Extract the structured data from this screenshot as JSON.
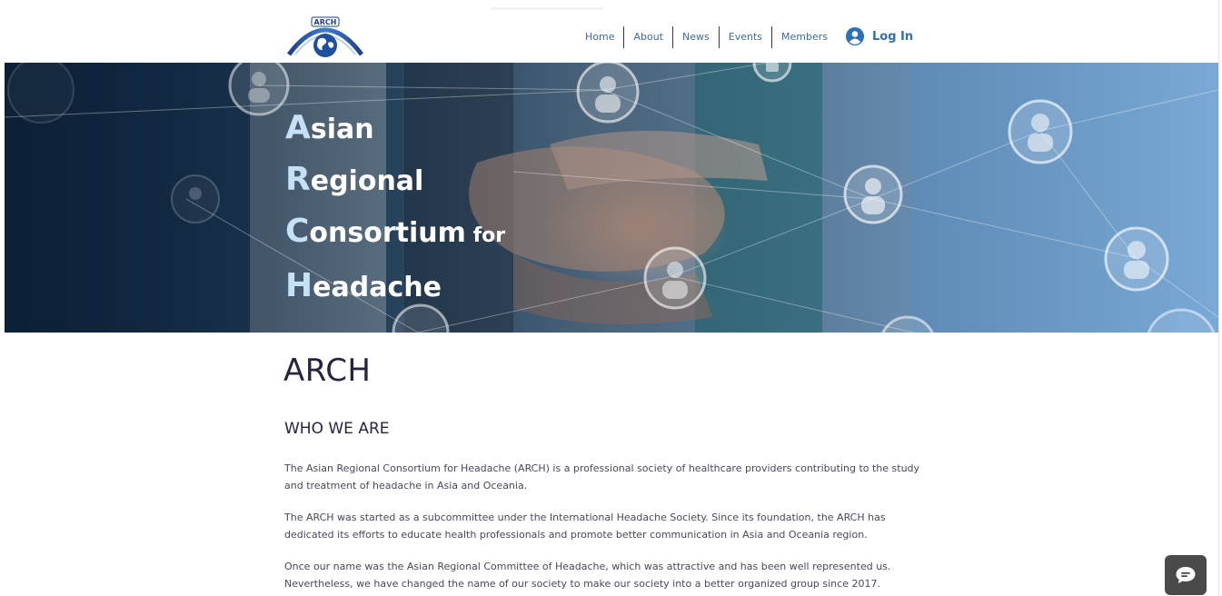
{
  "header": {
    "logo_text": "ARCH",
    "nav": [
      "Home",
      "About",
      "News",
      "Events",
      "Members"
    ],
    "login_label": "Log In"
  },
  "hero": {
    "lines": [
      {
        "cap": "A",
        "rest": "sian",
        "suffix": ""
      },
      {
        "cap": "R",
        "rest": "egional",
        "suffix": ""
      },
      {
        "cap": "C",
        "rest": "onsortium",
        "suffix": " for"
      },
      {
        "cap": "H",
        "rest": "eadache",
        "suffix": ""
      }
    ]
  },
  "main": {
    "title": "ARCH",
    "heading": "WHO WE ARE",
    "paragraphs": [
      "The Asian Regional Consortium for Headache (ARCH) is a professional society of healthcare providers contributing to the study and treatment of headache in Asia and Oceania.",
      "The ARCH was started as a subcommittee under the International Headache Society. Since its foundation, the ARCH has dedicated its efforts to educate health professionals and promote better communication in Asia and Oceania region.",
      "Once our name was the Asian Regional Committee of Headache, which was attractive and has been well represented us. Nevertheless, we have changed the name of our society to make our society into a better organized group since 2017."
    ]
  },
  "colors": {
    "title_text": "#2a2340",
    "nav_link": "#3a6c9c",
    "login": "#2f6fb4",
    "hero_capital": "#c6e0f5",
    "chat_bg": "#4a4a4a"
  },
  "icons": {
    "login": "user-circle-icon",
    "chat": "chat-bubble-icon",
    "logo": "arch-globe-logo"
  }
}
